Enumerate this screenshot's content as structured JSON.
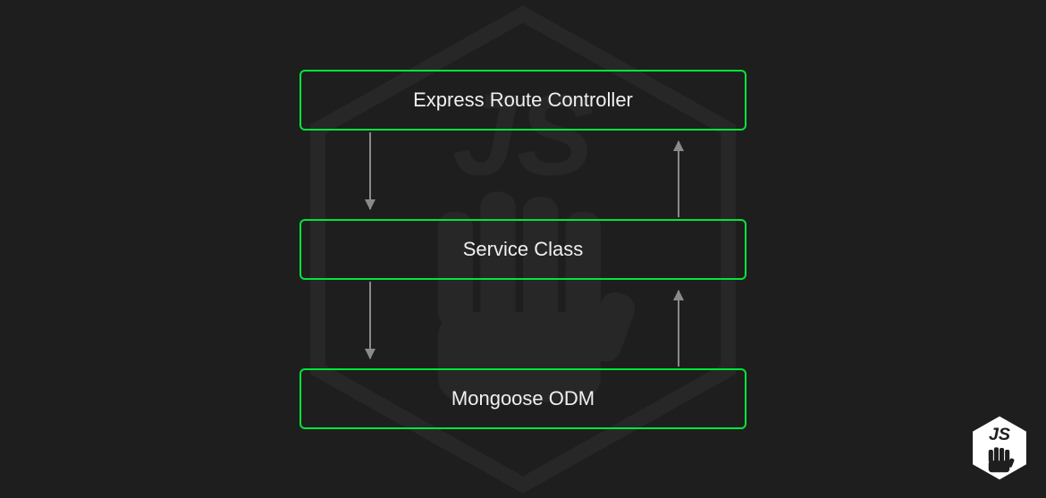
{
  "diagram": {
    "boxes": {
      "top": "Express Route Controller",
      "middle": "Service Class",
      "bottom": "Mongoose ODM"
    },
    "colors": {
      "border": "#00e639",
      "text": "#f0f0f0",
      "arrow": "#8a8a8a",
      "background": "#1e1e1e"
    }
  }
}
